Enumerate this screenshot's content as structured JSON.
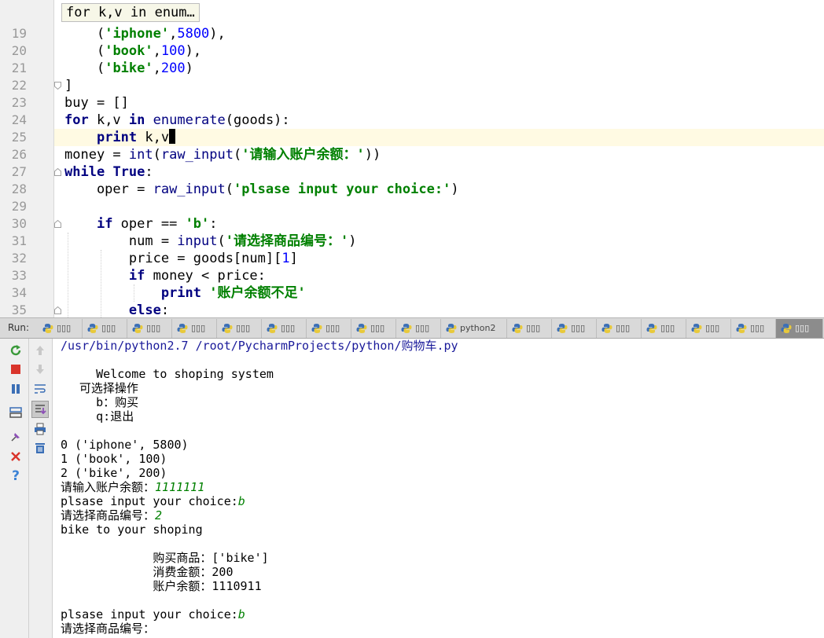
{
  "editor": {
    "breadcrumb": "for k,v in enum…",
    "line_numbers": [
      "19",
      "20",
      "21",
      "22",
      "23",
      "24",
      "25",
      "26",
      "27",
      "28",
      "29",
      "30",
      "31",
      "32",
      "33",
      "34",
      "35"
    ],
    "code": {
      "l19": {
        "i": "    ",
        "p1": "(",
        "s1": "'iphone'",
        "p2": ",",
        "n1": "5800",
        "p3": "),"
      },
      "l20": {
        "i": "    ",
        "p1": "(",
        "s1": "'book'",
        "p2": ",",
        "n1": "100",
        "p3": "),"
      },
      "l21": {
        "i": "    ",
        "p1": "(",
        "s1": "'bike'",
        "p2": ",",
        "n1": "200",
        "p3": ")"
      },
      "l22": {
        "t": "]"
      },
      "l23": {
        "t": "buy = []"
      },
      "l24": {
        "k1": "for",
        "t1": " k,v ",
        "k2": "in",
        "t2": " ",
        "b1": "enumerate",
        "t3": "(goods):"
      },
      "l25": {
        "i": "    ",
        "k1": "print",
        "t1": " k,v"
      },
      "l26": {
        "t1": "money = ",
        "b1": "int",
        "t2": "(",
        "b2": "raw_input",
        "t3": "(",
        "s1": "'请输入账户余额：'",
        "t4": "))"
      },
      "l27": {
        "k1": "while",
        "t1": " ",
        "k2": "True",
        "t2": ":"
      },
      "l28": {
        "t1": "    oper = ",
        "b1": "raw_input",
        "t2": "(",
        "s1": "'plsase input your choice:'",
        "t3": ")"
      },
      "l30": {
        "i": "    ",
        "k1": "if",
        "t1": " oper == ",
        "s1": "'b'",
        "t2": ":"
      },
      "l31": {
        "t1": "        num = ",
        "b1": "input",
        "t2": "(",
        "s1": "'请选择商品编号：'",
        "t3": ")"
      },
      "l32": {
        "t1": "        price = goods[num][",
        "n1": "1",
        "t2": "]"
      },
      "l33": {
        "i": "        ",
        "k1": "if",
        "t1": " money < price:"
      },
      "l34": {
        "i": "            ",
        "k1": "print",
        "t1": " ",
        "s1": "'账户余额不足'"
      },
      "l35": {
        "i": "        ",
        "k1": "else",
        "t1": ":"
      }
    }
  },
  "runbar": {
    "label": "Run:",
    "tabs": [
      "▯▯▯",
      "▯▯▯",
      "▯▯▯",
      "▯▯▯",
      "▯▯▯",
      "▯▯▯",
      "▯▯▯",
      "▯▯▯",
      "▯▯▯",
      "python2",
      "▯▯▯",
      "▯▯▯",
      "▯▯▯",
      "▯▯▯",
      "▯▯▯",
      "▯▯▯",
      "▯▯▯"
    ],
    "active_index": 16
  },
  "console": {
    "l0": {
      "path": "/usr/bin/python2.7 /root/PycharmProjects/python/购物车.py"
    },
    "l1": {
      "t": "     Welcome to shoping system"
    },
    "l2": {
      "t": "     可选择操作"
    },
    "l3": {
      "t": "     b：购买"
    },
    "l4": {
      "t": "     q:退出"
    },
    "l5": {
      "t": "0 ('iphone', 5800)"
    },
    "l6": {
      "t": "1 ('book', 100)"
    },
    "l7": {
      "t": "2 ('bike', 200)"
    },
    "l8": {
      "t": "请输入账户余额：",
      "in": "1111111"
    },
    "l9": {
      "t": "plsase input your choice:",
      "in": "b"
    },
    "l10": {
      "t": "请选择商品编号：",
      "in": "2"
    },
    "l11": {
      "t": "bike to your shoping"
    },
    "l12": {
      "t": "             购买商品：['bike']"
    },
    "l13": {
      "t": "             消费金额：200"
    },
    "l14": {
      "t": "             账户余额：1110911"
    },
    "l15": {
      "t": "plsase input your choice:",
      "in": "b"
    },
    "l16": {
      "t": "请选择商品编号："
    }
  },
  "colors": {
    "keyword": "#000080",
    "string": "#008000",
    "number": "#0000ff",
    "current_line": "#fffae3"
  },
  "icons": [
    "rerun-icon",
    "stop-icon",
    "pause-icon",
    "layout-icon",
    "pin-icon",
    "close-icon",
    "help-icon",
    "up-arrow-icon",
    "down-arrow-icon",
    "soft-wrap-icon",
    "scroll-to-end-icon",
    "print-icon",
    "trash-icon",
    "python-icon"
  ]
}
